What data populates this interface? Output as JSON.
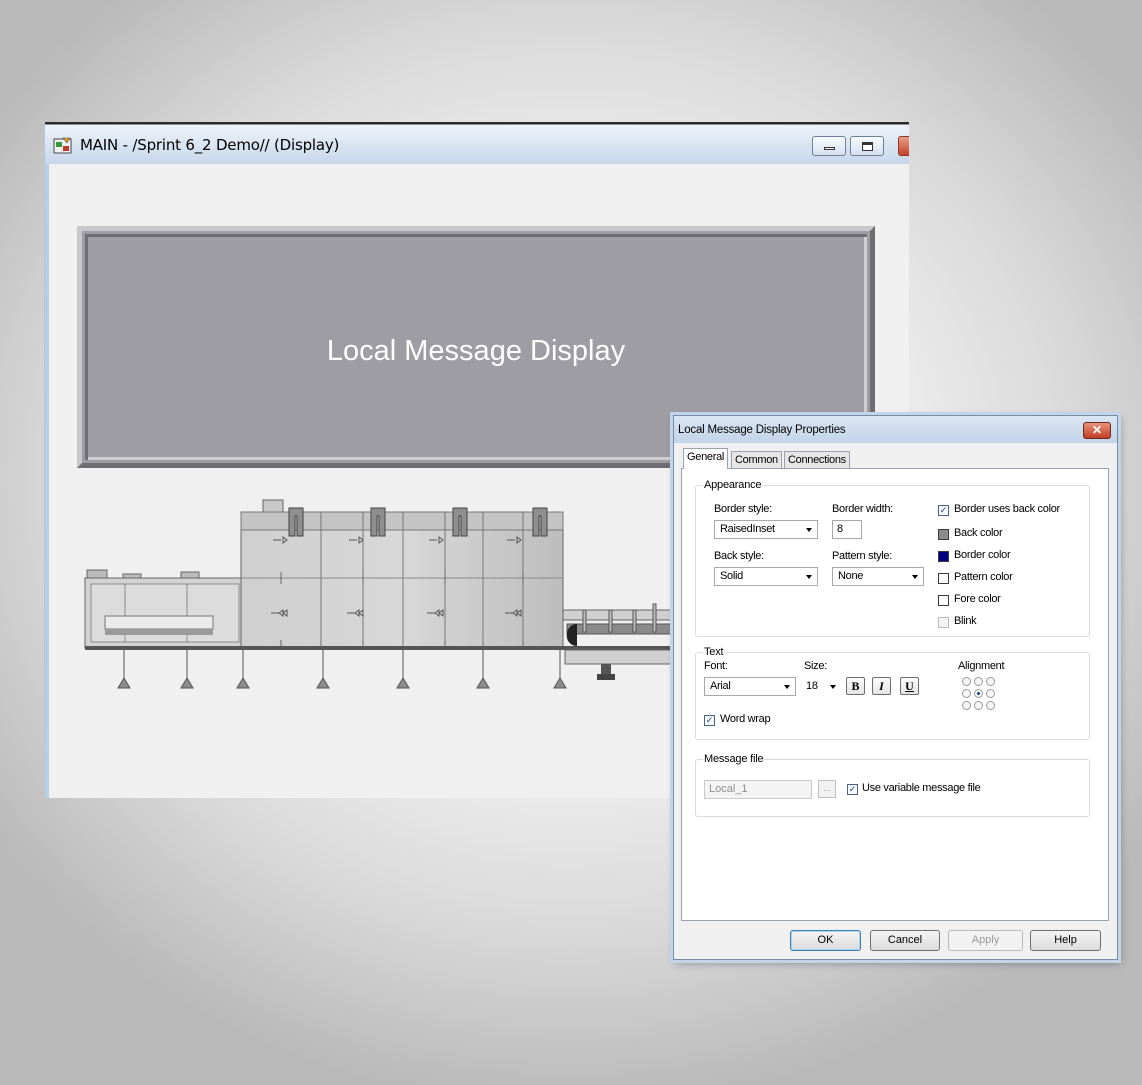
{
  "main_window": {
    "title": "MAIN - /Sprint 6_2 Demo// (Display)",
    "display_object": {
      "text": "Local Message Display"
    }
  },
  "dialog": {
    "title": "Local Message Display Properties",
    "close_glyph": "✕",
    "tabs": [
      "General",
      "Common",
      "Connections"
    ],
    "appearance": {
      "label": "Appearance",
      "border_style": {
        "label": "Border style:",
        "value": "RaisedInset"
      },
      "border_width": {
        "label": "Border width:",
        "value": "8"
      },
      "back_style": {
        "label": "Back style:",
        "value": "Solid"
      },
      "pattern_style": {
        "label": "Pattern style:",
        "value": "None"
      },
      "border_uses_back_color": {
        "label": "Border uses back color",
        "checked": true
      },
      "colors": [
        {
          "label": "Back color",
          "color": "#8c8c8c"
        },
        {
          "label": "Border color",
          "color": "#000080"
        },
        {
          "label": "Pattern color",
          "color": "#ffffff"
        },
        {
          "label": "Fore color",
          "color": "#ffffff"
        }
      ],
      "blink": {
        "label": "Blink",
        "checked": false,
        "disabled": true
      }
    },
    "text_group": {
      "label": "Text",
      "font": {
        "label": "Font:",
        "value": "Arial"
      },
      "size": {
        "label": "Size:",
        "value": "18"
      },
      "bold": "B",
      "italic": "I",
      "underline": "U",
      "alignment": {
        "label": "Alignment",
        "selected_row": 1,
        "selected_col": 1
      },
      "word_wrap": {
        "label": "Word wrap",
        "checked": true
      }
    },
    "message_file": {
      "label": "Message file",
      "value": "Local_1",
      "browse": "...",
      "use_variable": {
        "label": "Use variable message file",
        "checked": true
      }
    },
    "buttons": {
      "ok": "OK",
      "cancel": "Cancel",
      "apply": "Apply",
      "help": "Help"
    }
  }
}
